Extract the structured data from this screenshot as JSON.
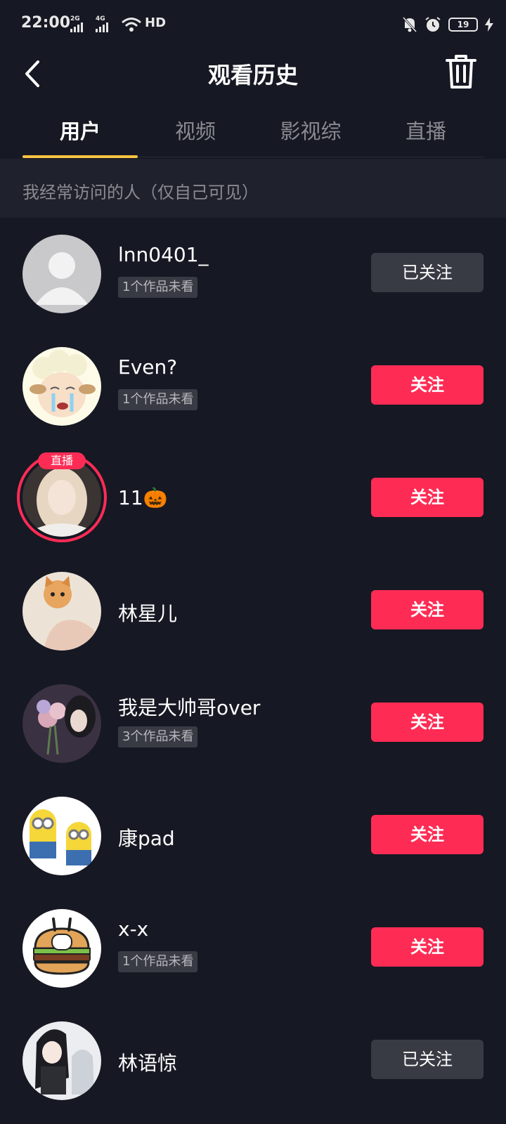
{
  "status_bar": {
    "time": "22:00",
    "signal1_label": "2G",
    "signal2_label": "4G",
    "network_label": "HD",
    "battery": "19"
  },
  "header": {
    "title": "观看历史",
    "back_icon": "chevron-left-icon",
    "delete_icon": "trash-icon"
  },
  "tabs": [
    {
      "label": "用户",
      "active": true
    },
    {
      "label": "视频",
      "active": false
    },
    {
      "label": "影视综",
      "active": false
    },
    {
      "label": "直播",
      "active": false
    }
  ],
  "section": {
    "title": "我经常访问的人（仅自己可见）"
  },
  "users": [
    {
      "name": "lnn0401_",
      "badge": "1个作品未看",
      "button": "已关注",
      "following": true
    },
    {
      "name": "Even?",
      "badge": "1个作品未看",
      "button": "关注",
      "following": false
    },
    {
      "name": "11🎃",
      "badge": "",
      "button": "关注",
      "following": false,
      "live": "直播"
    },
    {
      "name": "林星儿",
      "badge": "",
      "button": "关注",
      "following": false
    },
    {
      "name": "我是大帅哥over",
      "badge": "3个作品未看",
      "button": "关注",
      "following": false
    },
    {
      "name": "康pad",
      "badge": "",
      "button": "关注",
      "following": false
    },
    {
      "name": "x-x",
      "badge": "1个作品未看",
      "button": "关注",
      "following": false
    },
    {
      "name": "林语惊",
      "badge": "",
      "button": "已关注",
      "following": true
    }
  ],
  "colors": {
    "background": "#161823",
    "follow_button": "#fe2c55",
    "followed_button": "#393b44",
    "tab_indicator": "#f6c342"
  }
}
